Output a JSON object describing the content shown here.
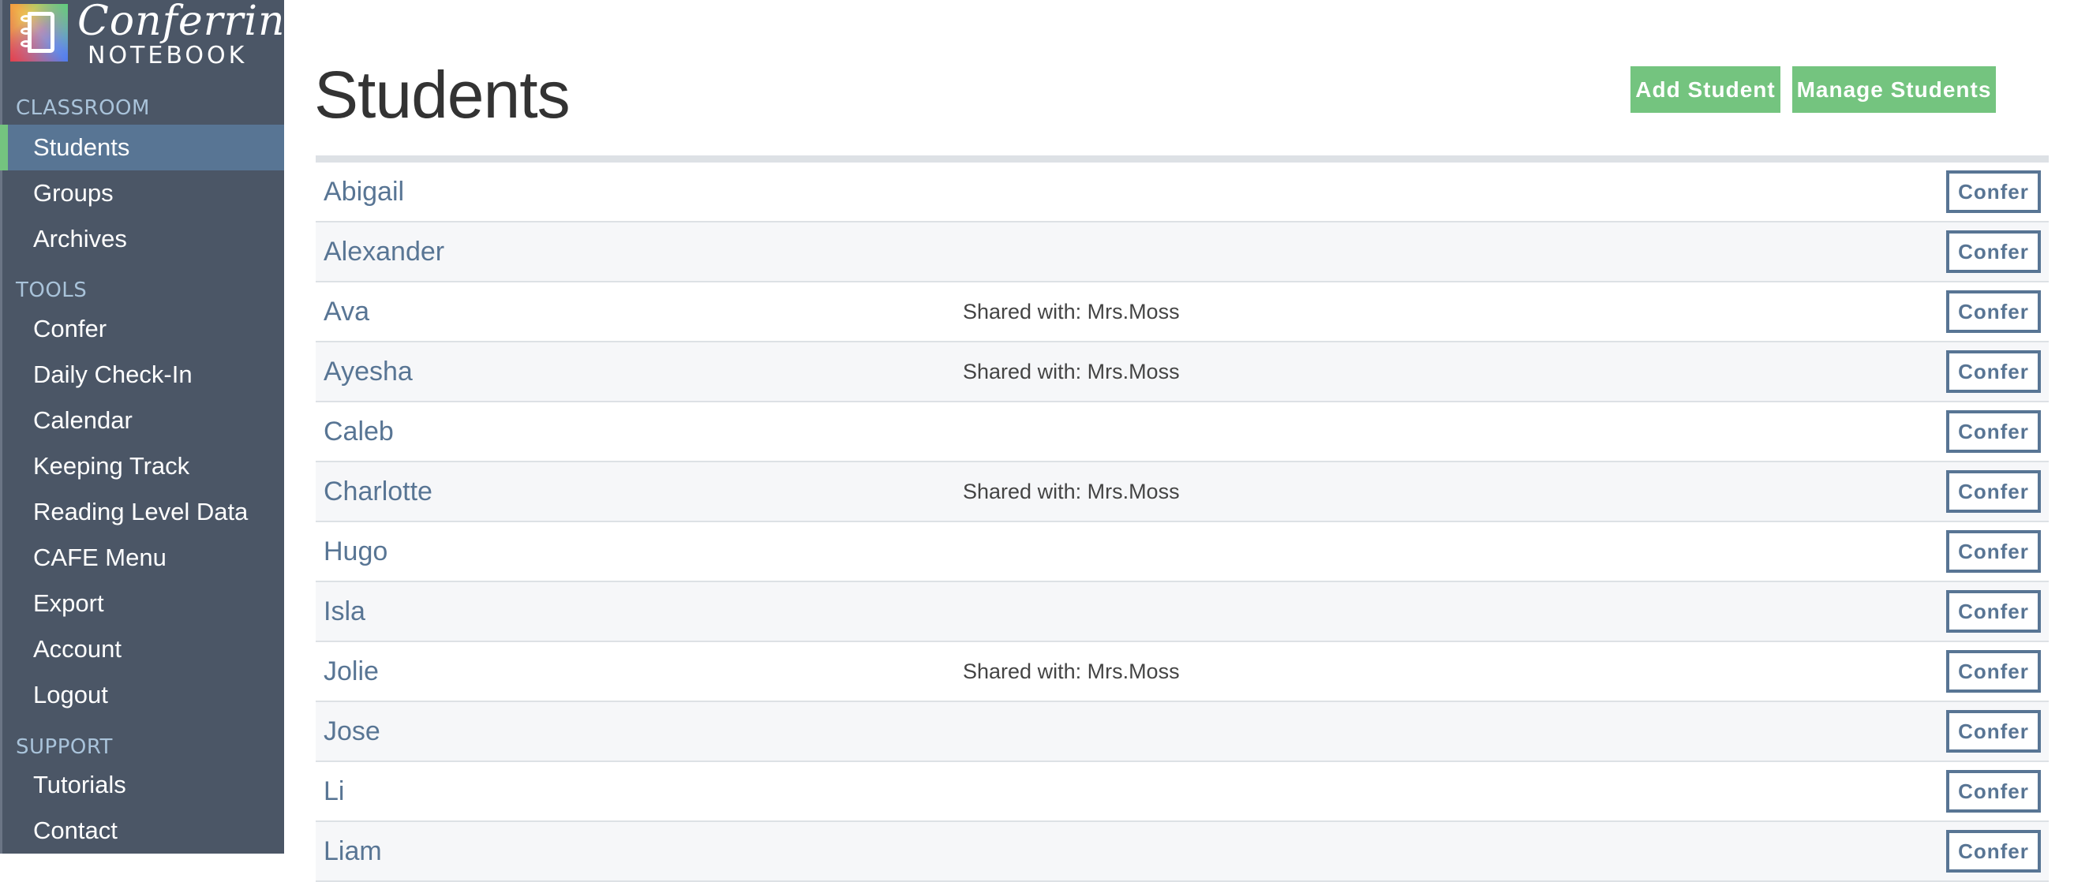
{
  "app": {
    "logo_script": "Conferring",
    "logo_caps": "NOTEBOOK",
    "accent_green": "#74c47f",
    "accent_blue": "#587594"
  },
  "sidebar": {
    "sections": [
      {
        "header": "CLASSROOM",
        "items": [
          {
            "label": "Students",
            "active": true
          },
          {
            "label": "Groups"
          },
          {
            "label": "Archives"
          }
        ]
      },
      {
        "header": "TOOLS",
        "items": [
          {
            "label": "Confer"
          },
          {
            "label": "Daily Check-In"
          },
          {
            "label": "Calendar"
          },
          {
            "label": "Keeping Track"
          },
          {
            "label": "Reading Level Data"
          },
          {
            "label": "CAFE Menu"
          },
          {
            "label": "Export"
          },
          {
            "label": "Account"
          },
          {
            "label": "Logout"
          }
        ]
      },
      {
        "header": "SUPPORT",
        "items": [
          {
            "label": "Tutorials"
          },
          {
            "label": "Contact"
          }
        ]
      }
    ]
  },
  "main": {
    "title": "Students",
    "add_student_label": "Add Student",
    "manage_students_label": "Manage Students",
    "confer_label": "Confer",
    "students": [
      {
        "name": "Abigail",
        "shared": ""
      },
      {
        "name": "Alexander",
        "shared": ""
      },
      {
        "name": "Ava",
        "shared": "Shared with: Mrs.Moss"
      },
      {
        "name": "Ayesha",
        "shared": "Shared with: Mrs.Moss"
      },
      {
        "name": "Caleb",
        "shared": ""
      },
      {
        "name": "Charlotte",
        "shared": "Shared with: Mrs.Moss"
      },
      {
        "name": "Hugo",
        "shared": ""
      },
      {
        "name": "Isla",
        "shared": ""
      },
      {
        "name": "Jolie",
        "shared": "Shared with: Mrs.Moss"
      },
      {
        "name": "Jose",
        "shared": ""
      },
      {
        "name": "Li",
        "shared": ""
      },
      {
        "name": "Liam",
        "shared": ""
      }
    ]
  }
}
